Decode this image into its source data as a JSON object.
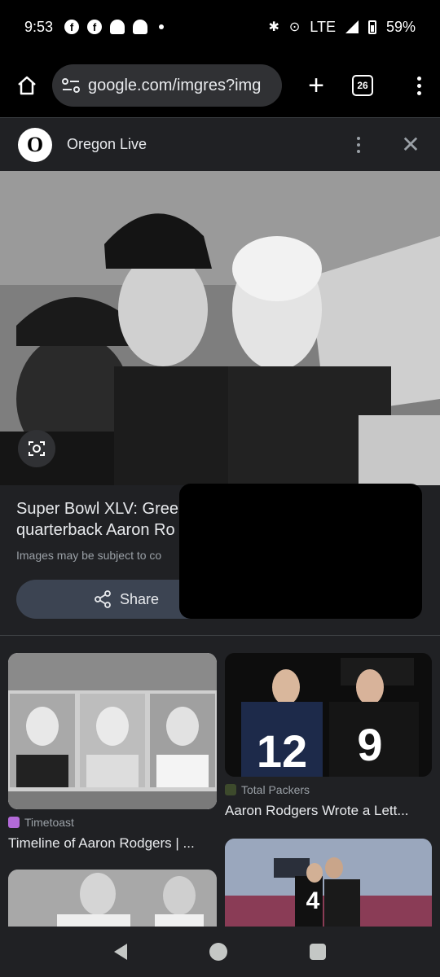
{
  "status_bar": {
    "time": "9:53",
    "network": "LTE",
    "battery": "59%"
  },
  "browser": {
    "url": "google.com/imgres?img",
    "tab_count": "26"
  },
  "source": {
    "name": "Oregon Live"
  },
  "result": {
    "title_line1": "Super Bowl XLV: Gree",
    "title_line2": "quarterback Aaron Ro",
    "note": "Images may be subject to co",
    "share_label": "Share"
  },
  "related": [
    {
      "source": "Timetoast",
      "title": "Timeline of Aaron Rodgers | ..."
    },
    {
      "source": "Total Packers",
      "title": "Aaron Rodgers Wrote a Lett..."
    }
  ],
  "jerseys": [
    "12",
    "9",
    "4"
  ],
  "colors": {
    "background": "#202124",
    "share_button": "#3c4452",
    "text_secondary": "#9aa0a6"
  }
}
